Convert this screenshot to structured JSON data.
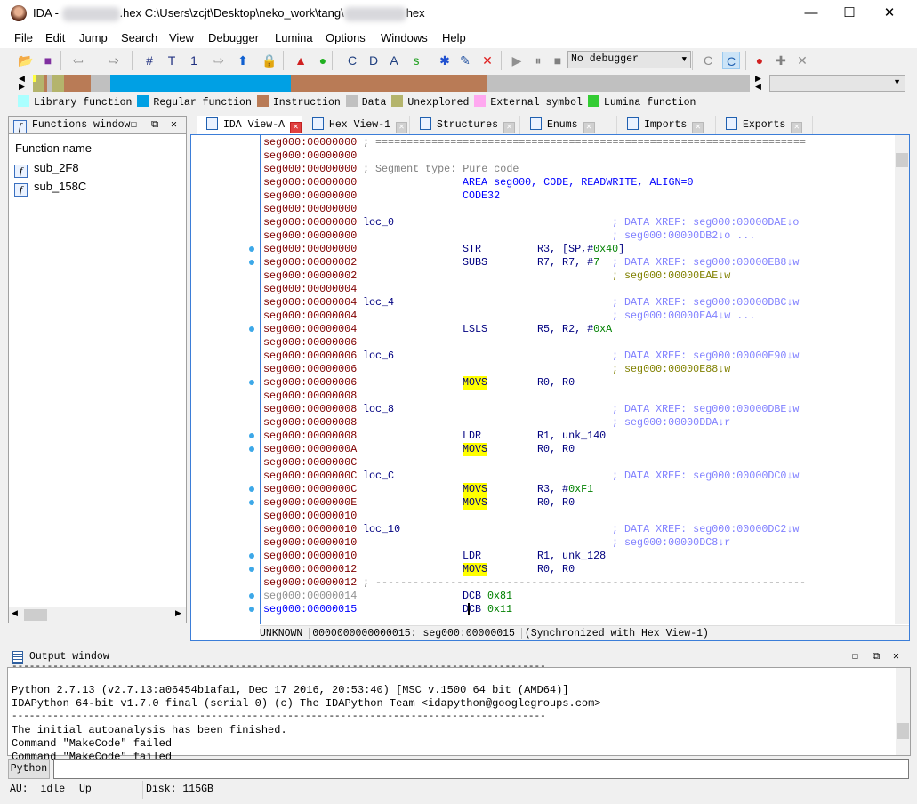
{
  "title": {
    "app": "IDA - ",
    "middle": ".hex C:\\Users\\zcjt\\Desktop\\neko_work\\tang\\",
    "end": "hex"
  },
  "window_controls": {
    "minimize": "—",
    "maximize": "☐",
    "close": "✕"
  },
  "menu": [
    "File",
    "Edit",
    "Jump",
    "Search",
    "View",
    "Debugger",
    "Lumina",
    "Options",
    "Windows",
    "Help"
  ],
  "toolbar": {
    "icons": [
      "open-icon",
      "save-icon",
      "back-icon",
      "forward-icon",
      "search-sequence-icon",
      "search-text-icon",
      "search-immediate-icon",
      "next-unexplored-icon",
      "jump-up-icon",
      "lock-icon",
      "warning-icon",
      "green-circle-icon",
      "make-code-icon",
      "make-data-icon",
      "make-ascii-icon",
      "make-string-icon",
      "struct-icon",
      "edit-icon",
      "undefine-icon",
      "run-icon",
      "pause-icon",
      "stop-icon",
      "attach-icon",
      "switch-icon",
      "breakpoint-icon",
      "add-tracepoint-icon",
      "delete-tracepoint-icon"
    ],
    "debugger_select": "No debugger"
  },
  "navband": {
    "segments": [
      {
        "type": "Unexplored",
        "color": "#b4b46c",
        "from": 0,
        "to": 1.5
      },
      {
        "type": "Regular function",
        "color": "#00a0e4",
        "from": 1.5,
        "to": 1.6
      },
      {
        "type": "Instruction",
        "color": "#b97b56",
        "from": 1.6,
        "to": 2.0
      },
      {
        "type": "Data",
        "color": "#c0c0c0",
        "from": 2.0,
        "to": 2.6
      },
      {
        "type": "Unexplored",
        "color": "#b4b46c",
        "from": 2.6,
        "to": 4.4
      },
      {
        "type": "Instruction",
        "color": "#b97b56",
        "from": 4.4,
        "to": 8.1
      },
      {
        "type": "Data",
        "color": "#c0c0c0",
        "from": 8.1,
        "to": 10.8
      },
      {
        "type": "Regular function",
        "color": "#00a0e4",
        "from": 10.8,
        "to": 36.0
      },
      {
        "type": "Instruction",
        "color": "#b97b56",
        "from": 36.0,
        "to": 63.4
      },
      {
        "type": "Data",
        "color": "#c0c0c0",
        "from": 63.4,
        "to": 100
      }
    ]
  },
  "legend": [
    {
      "label": "Library function",
      "color": "#aaffff"
    },
    {
      "label": "Regular function",
      "color": "#00a0e4"
    },
    {
      "label": "Instruction",
      "color": "#b97b56"
    },
    {
      "label": "Data",
      "color": "#c0c0c0"
    },
    {
      "label": "Unexplored",
      "color": "#b4b46c"
    },
    {
      "label": "External symbol",
      "color": "#ffa8f0"
    },
    {
      "label": "Lumina function",
      "color": "#33cc33"
    }
  ],
  "functions_window": {
    "title": "Functions window",
    "column": "Function name",
    "items": [
      "sub_2F8",
      "sub_158C"
    ]
  },
  "tabs": [
    {
      "label": "IDA View-A",
      "active": true
    },
    {
      "label": "Hex View-1"
    },
    {
      "label": "Structures"
    },
    {
      "label": "Enums"
    },
    {
      "label": "Imports"
    },
    {
      "label": "Exports"
    }
  ],
  "disasm": [
    {
      "addr": "seg000:00000000",
      "sep": "; ====================================================================="
    },
    {
      "addr": "seg000:00000000"
    },
    {
      "addr": "seg000:00000000",
      "cmt": "; Segment type: Pure code"
    },
    {
      "addr": "seg000:00000000",
      "dir": "AREA seg000, CODE, READWRITE, ALIGN=0"
    },
    {
      "addr": "seg000:00000000",
      "dir": "CODE32"
    },
    {
      "addr": "seg000:00000000"
    },
    {
      "addr": "seg000:00000000",
      "label": "loc_0",
      "xref": "; DATA XREF: seg000:00000DAE↓o"
    },
    {
      "addr": "seg000:00000000",
      "xref": "; seg000:00000DB2↓o ..."
    },
    {
      "addr": "seg000:00000000",
      "mnem": "STR",
      "ops": "R3, [SP,#",
      "num": "0x40",
      "tail": "]",
      "dot": true
    },
    {
      "addr": "seg000:00000002",
      "mnem": "SUBS",
      "ops": "R7, R7, #",
      "num": "7",
      "xref": "; DATA XREF: seg000:00000EB8↓w",
      "dot": true
    },
    {
      "addr": "seg000:00000002",
      "xref": "; seg000:00000EAE↓w",
      "olive": true
    },
    {
      "addr": "seg000:00000004"
    },
    {
      "addr": "seg000:00000004",
      "label": "loc_4",
      "xref": "; DATA XREF: seg000:00000DBC↓w"
    },
    {
      "addr": "seg000:00000004",
      "xref": "; seg000:00000EA4↓w ..."
    },
    {
      "addr": "seg000:00000004",
      "mnem": "LSLS",
      "ops": "R5, R2, #",
      "num": "0xA",
      "dot": true
    },
    {
      "addr": "seg000:00000006"
    },
    {
      "addr": "seg000:00000006",
      "label": "loc_6",
      "xref": "; DATA XREF: seg000:00000E90↓w"
    },
    {
      "addr": "seg000:00000006",
      "xref": "; seg000:00000E88↓w",
      "olive": true
    },
    {
      "addr": "seg000:00000006",
      "mnem": "MOVS",
      "ops": "R0, R0",
      "hl": true,
      "dot": true
    },
    {
      "addr": "seg000:00000008"
    },
    {
      "addr": "seg000:00000008",
      "label": "loc_8",
      "xref": "; DATA XREF: seg000:00000DBE↓w"
    },
    {
      "addr": "seg000:00000008",
      "xref": "; seg000:00000DDA↓r"
    },
    {
      "addr": "seg000:00000008",
      "mnem": "LDR",
      "ops": "R1, unk_140",
      "dot": true
    },
    {
      "addr": "seg000:0000000A",
      "mnem": "MOVS",
      "ops": "R0, R0",
      "hl": true,
      "dot": true
    },
    {
      "addr": "seg000:0000000C"
    },
    {
      "addr": "seg000:0000000C",
      "label": "loc_C",
      "xref": "; DATA XREF: seg000:00000DC0↓w"
    },
    {
      "addr": "seg000:0000000C",
      "mnem": "MOVS",
      "ops": "R3, #",
      "num": "0xF1",
      "hl": true,
      "dot": true
    },
    {
      "addr": "seg000:0000000E",
      "mnem": "MOVS",
      "ops": "R0, R0",
      "hl": true,
      "dot": true
    },
    {
      "addr": "seg000:00000010"
    },
    {
      "addr": "seg000:00000010",
      "label": "loc_10",
      "xref": "; DATA XREF: seg000:00000DC2↓w"
    },
    {
      "addr": "seg000:00000010",
      "xref": "; seg000:00000DC8↓r"
    },
    {
      "addr": "seg000:00000010",
      "mnem": "LDR",
      "ops": "R1, unk_128",
      "dot": true
    },
    {
      "addr": "seg000:00000012",
      "mnem": "MOVS",
      "ops": "R0, R0",
      "hl": true,
      "dot": true
    },
    {
      "addr": "seg000:00000012",
      "sep": "; ---------------------------------------------------------------------"
    },
    {
      "addr": "seg000:00000014",
      "addrStyle": "gray",
      "mnem": "DCB",
      "ops": "",
      "num": "0x81",
      "dot": true
    },
    {
      "addr": "seg000:00000015",
      "addrStyle": "blue",
      "mnem": "DCB",
      "ops": "",
      "num": "0x11",
      "dot": true
    }
  ],
  "disasm_status": {
    "type": "UNKNOWN",
    "offset": "0000000000000015: seg000:00000015",
    "sync": "(Synchronized with Hex View-1)"
  },
  "output_window": {
    "title": "Output window",
    "lines": [
      "-------------------------------------------------------------------------------------------",
      "Python 2.7.13 (v2.7.13:a06454b1afa1, Dec 17 2016, 20:53:40) [MSC v.1500 64 bit (AMD64)]",
      "IDAPython 64-bit v1.7.0 final (serial 0) (c) The IDAPython Team <idapython@googlegroups.com>",
      "-------------------------------------------------------------------------------------------",
      "The initial autoanalysis has been finished.",
      "Command \"MakeCode\" failed",
      "Command \"MakeCode\" failed"
    ],
    "input_button": "Python",
    "input_value": ""
  },
  "status": {
    "au": "AU:  idle",
    "dir": "Up",
    "disk": "Disk: 115GB"
  }
}
